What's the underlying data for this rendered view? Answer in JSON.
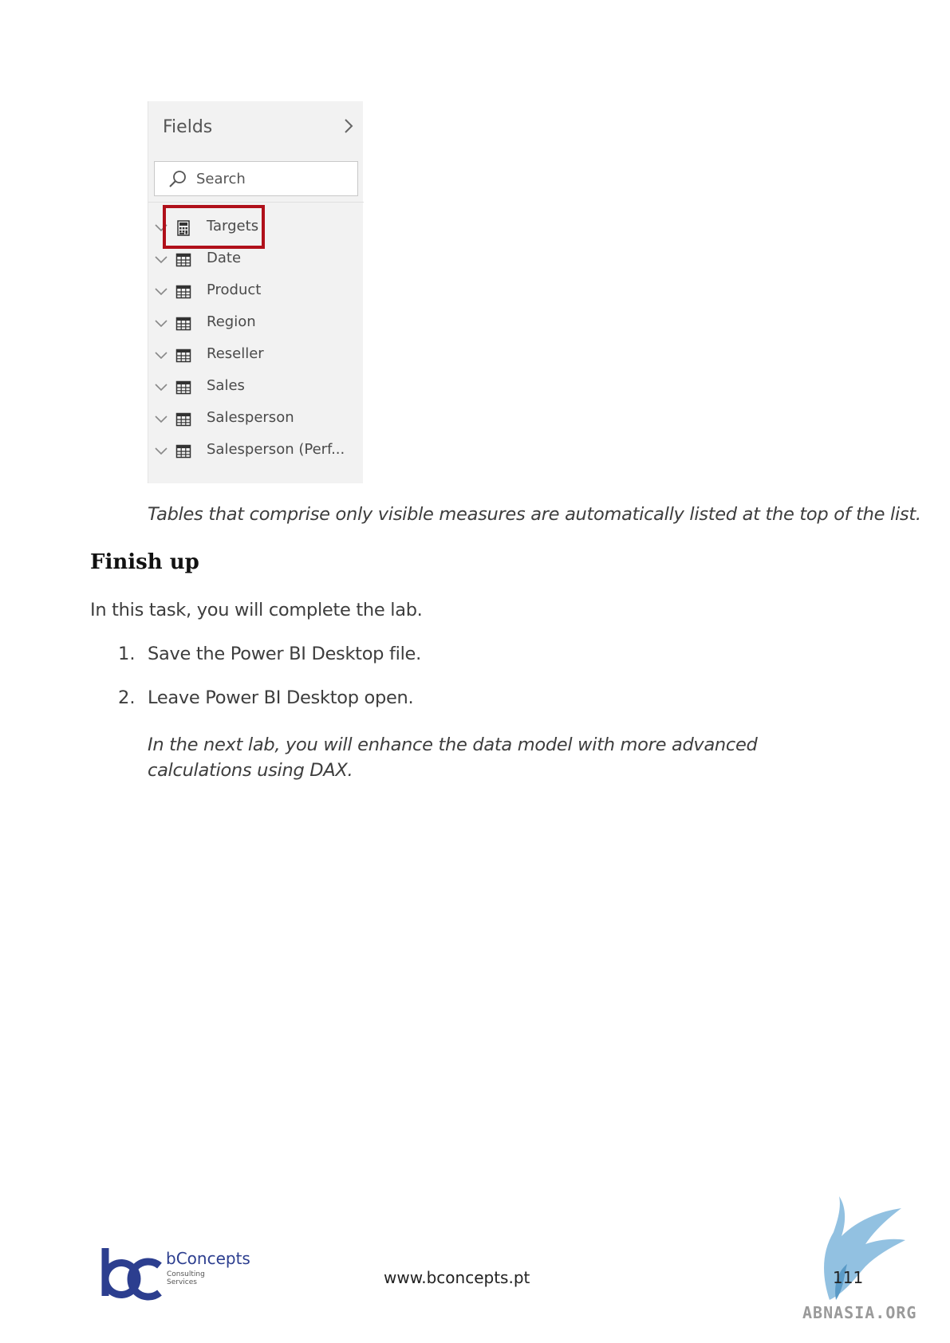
{
  "fields_pane": {
    "title": "Fields",
    "search_placeholder": "Search",
    "items": [
      {
        "label": "Targets",
        "icon": "calculator-icon",
        "highlighted": true
      },
      {
        "label": "Date",
        "icon": "table-icon"
      },
      {
        "label": "Product",
        "icon": "table-icon"
      },
      {
        "label": "Region",
        "icon": "table-icon"
      },
      {
        "label": "Reseller",
        "icon": "table-icon"
      },
      {
        "label": "Sales",
        "icon": "table-icon"
      },
      {
        "label": "Salesperson",
        "icon": "table-icon"
      },
      {
        "label": "Salesperson (Perf...",
        "icon": "table-icon"
      }
    ],
    "highlight_color": "#b0101a"
  },
  "caption": "Tables that comprise only visible measures are automatically listed at the top of the list.",
  "section": {
    "heading": "Finish up",
    "intro": "In this task, you will complete the lab.",
    "steps": [
      {
        "num": "1.",
        "text": "Save the Power BI Desktop file."
      },
      {
        "num": "2.",
        "text": "Leave Power BI Desktop open."
      }
    ],
    "note": "In the next lab, you will enhance the data model with more advanced calculations using DAX."
  },
  "footer": {
    "logo_name": "bConcepts",
    "logo_sub_1": "Consulting",
    "logo_sub_2": "Services",
    "website": "www.bconcepts.pt",
    "page_number": "111",
    "watermark": "ABNASIA.ORG"
  }
}
